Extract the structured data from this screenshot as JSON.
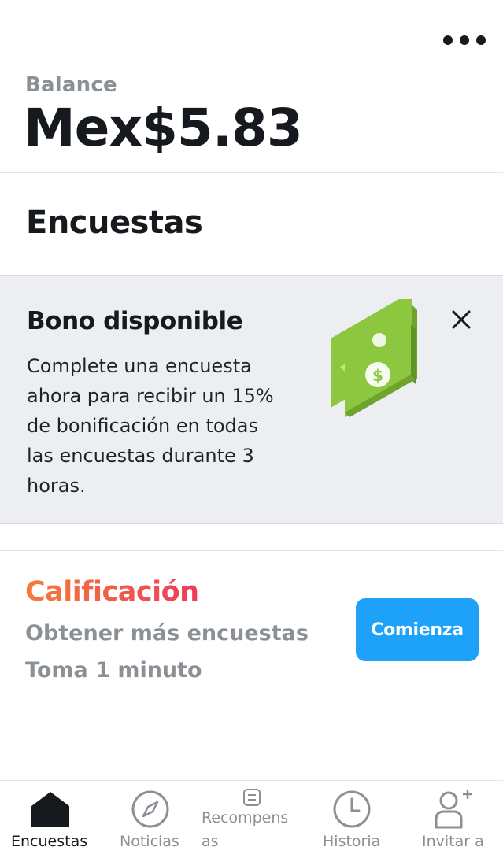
{
  "header": {
    "more_icon": "more-horizontal-icon",
    "balance_label": "Balance",
    "balance_value": "Mex$5.83"
  },
  "main": {
    "section_title": "Encuestas",
    "bonus": {
      "title": "Bono disponible",
      "text": "Complete una encuesta ahora para recibir un 15% de bonificación en todas las encuestas durante 3 horas.",
      "close_icon": "close-icon",
      "illustration": "money-bills-icon"
    },
    "rating": {
      "title": "Calificación",
      "line1": "Obtener más encuestas",
      "line2": "Toma 1 minuto",
      "button_label": "Comienza"
    }
  },
  "nav": {
    "items": [
      {
        "label": "Encuestas",
        "icon": "home-icon",
        "active": true
      },
      {
        "label": "Noticias",
        "icon": "compass-icon",
        "active": false
      },
      {
        "label_line1": "Recompens",
        "label_line2": "as",
        "icon": "rewards-icon",
        "active": false
      },
      {
        "label": "Historia",
        "icon": "clock-icon",
        "active": false
      },
      {
        "label": "Invitar a",
        "icon": "add-user-icon",
        "active": false
      }
    ]
  },
  "colors": {
    "accent": "#1ea1f8",
    "gradient_start": "#f47d3a",
    "gradient_end": "#ee3b5a",
    "muted_text": "#8b9097",
    "card_bg": "#eceef2",
    "money_green": "#8dc63f"
  }
}
